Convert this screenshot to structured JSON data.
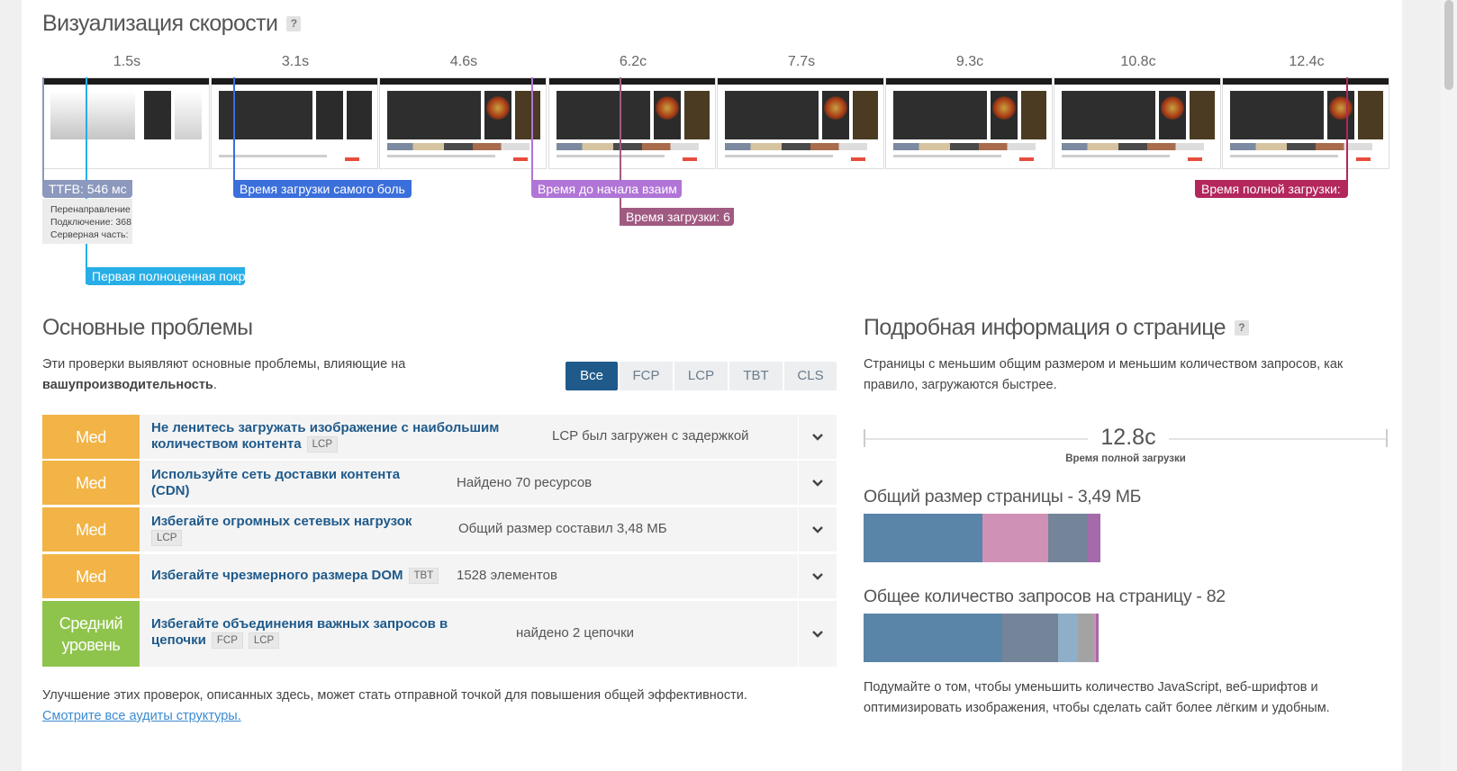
{
  "speed": {
    "title": "Визуализация скорости",
    "help": "?",
    "times": [
      "1.5s",
      "3.1s",
      "4.6s",
      "6.2c",
      "7.7s",
      "9.3c",
      "10.8c",
      "12.4c"
    ],
    "markers": {
      "ttfb": "TTFB: 546 мс",
      "lcp": "Время загрузки самого боль",
      "tti": "Время до начала взаим",
      "load": "Время загрузки: 6",
      "fully": "Время полной загрузки:",
      "fcp": "Первая полноценная покр"
    },
    "ttfb_details": [
      "Перенаправление",
      "Подключение: 368",
      "Серверная часть:"
    ]
  },
  "problems": {
    "title": "Основные проблемы",
    "desc_line1": "Эти проверки выявляют основные проблемы, влияющие на",
    "desc_bold": "вашупроизводительность",
    "desc_end": ".",
    "filters": [
      "Все",
      "FCP",
      "LCP",
      "TBT",
      "CLS"
    ],
    "items": [
      {
        "severity": "Med",
        "title_line1": "Не ленитесь загружать изображение с наибольшим",
        "title_line2": "количеством контента",
        "tags": [
          "LCP"
        ],
        "found": "LCP был загружен с задержкой"
      },
      {
        "severity": "Med",
        "title_line1": "Используйте сеть доставки контента",
        "title_line2": "(CDN)",
        "tags": [],
        "found": "Найдено 70 ресурсов"
      },
      {
        "severity": "Med",
        "title_line1": "Избегайте огромных сетевых нагрузок",
        "title_line2": "",
        "tags": [
          "LCP"
        ],
        "found": "Общий размер составил 3,48 МБ"
      },
      {
        "severity": "Med",
        "title_line1": "Избегайте чрезмерного размера DOM",
        "title_line2": "",
        "tags": [
          "TBT"
        ],
        "found": "1528 элементов"
      },
      {
        "severity_line1": "Средний",
        "severity_line2": "уровень",
        "title_line1": "Избегайте объединения важных запросов в",
        "title_line2": "цепочки",
        "tags": [
          "FCP",
          "LCP"
        ],
        "found": "найдено 2 цепочки"
      }
    ],
    "footer_text": "Улучшение этих проверок, описанных здесь, может стать отправной точкой для повышения общей эффективности.",
    "footer_link": "Смотрите все аудиты структуры."
  },
  "details": {
    "title": "Подробная информация о странице",
    "help": "?",
    "desc_line1": "Страницы с меньшим общим размером и меньшим количеством запросов, как",
    "desc_line2": "правило, загружаются быстрее.",
    "fully_loaded_value": "12.8c",
    "fully_loaded_label": "Время полной загрузки",
    "size_title": "Общий размер страницы - 3,49 МБ",
    "requests_title": "Общее количество запросов на страницу - 82",
    "size_breakdown": [
      {
        "color": "#5a84a8",
        "fraction": 0.227
      },
      {
        "color": "#cf92b6",
        "fraction": 0.126
      },
      {
        "color": "#748599",
        "fraction": 0.074
      },
      {
        "color": "#a46aaa",
        "fraction": 0.026
      }
    ],
    "requests_breakdown": [
      {
        "color": "#5a84a8",
        "fraction": 0.265
      },
      {
        "color": "#748599",
        "fraction": 0.107
      },
      {
        "color": "#8faec8",
        "fraction": 0.037
      },
      {
        "color": "#a3a3a3",
        "fraction": 0.031
      },
      {
        "color": "#cf92b6",
        "fraction": 0.004
      },
      {
        "color": "#a46aaa",
        "fraction": 0.006
      }
    ],
    "note_line1": "Подумайте о том, чтобы уменьшить количество JavaScript, веб-шрифтов и",
    "note_line2": "оптимизировать изображения, чтобы сделать сайт более лёгким и удобным."
  },
  "colors": {
    "ttfb": "#8c98bd",
    "fcp": "#27aee6",
    "lcp": "#3b6fdc",
    "tti": "#b075d6",
    "load": "#a05a82",
    "fully": "#b3275d",
    "med": "#f2b446",
    "medium": "#8fc44c",
    "accent": "#1f5a8b"
  }
}
